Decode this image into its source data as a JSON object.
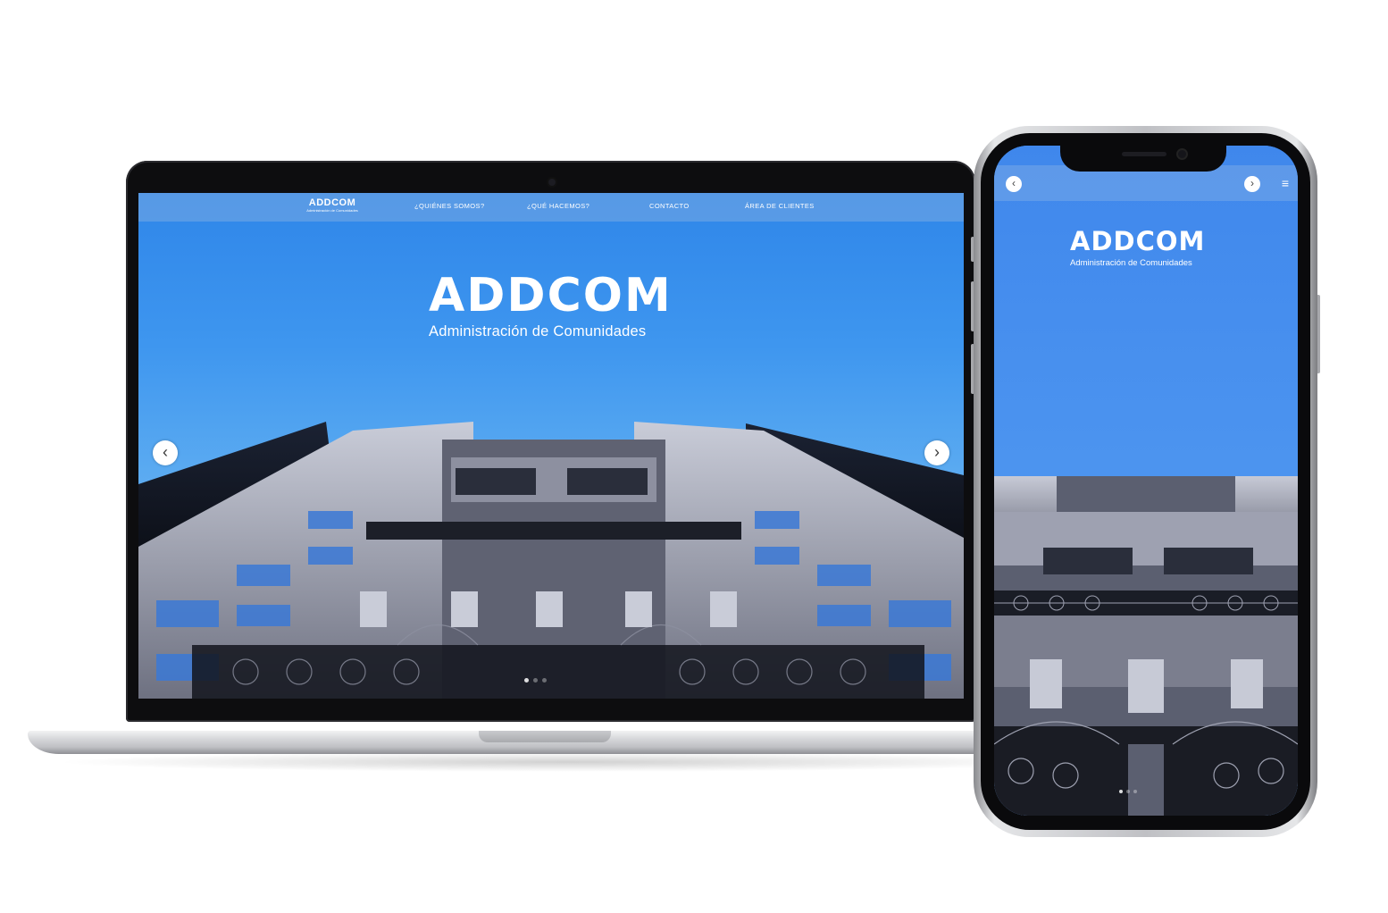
{
  "desktop": {
    "logo": {
      "word": "ADDCOM",
      "subtitle": "Administración de Comunidades"
    },
    "nav": {
      "items": [
        {
          "label": "¿QUIÉNES SOMOS?"
        },
        {
          "label": "¿QUÉ HACEMOS?"
        },
        {
          "label": "CONTACTO"
        },
        {
          "label": "ÁREA DE CLIENTES"
        }
      ]
    },
    "hero": {
      "word": "ADDCOM",
      "subtitle": "Administración de Comunidades"
    },
    "carousel": {
      "prev_icon": "chevron-left-icon",
      "next_icon": "chevron-right-icon",
      "prev_glyph": "‹",
      "next_glyph": "›",
      "slide_count": 3,
      "active_slide": 1
    }
  },
  "mobile": {
    "hero": {
      "word": "ADDCOM",
      "subtitle": "Administración de Comunidades"
    },
    "prev_glyph": "‹",
    "next_glyph": "›",
    "menu_glyph": "≡",
    "menu_icon": "hamburger-menu-icon",
    "slide_count": 3,
    "active_slide": 1
  },
  "colors": {
    "sky": "#2f86e9",
    "text": "#ffffff"
  }
}
